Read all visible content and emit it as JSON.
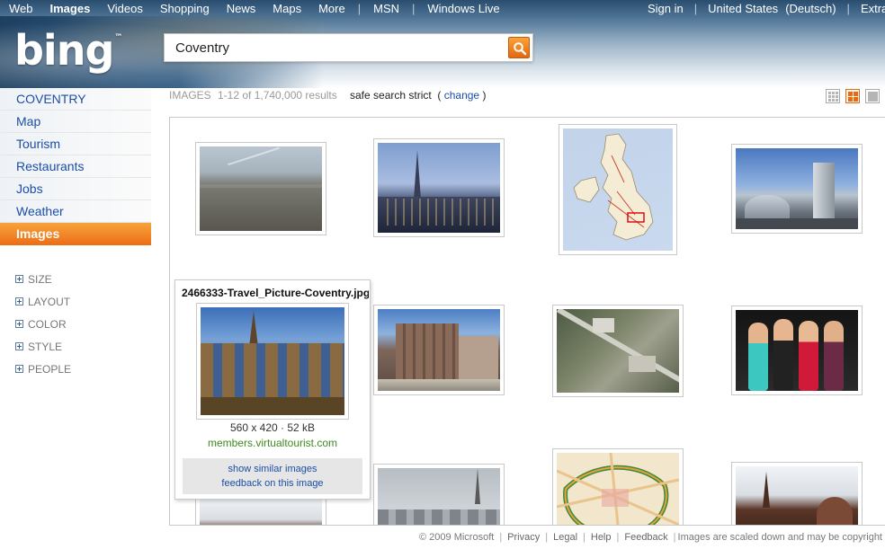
{
  "topnav": {
    "left": [
      "Web",
      "Images",
      "Videos",
      "Shopping",
      "News",
      "Maps",
      "More"
    ],
    "active": "Images",
    "msn": "MSN",
    "windows_live": "Windows Live",
    "sign_in": "Sign in",
    "region": "United States",
    "language": "(Deutsch)",
    "extras": "Extra"
  },
  "logo": {
    "text": "bing",
    "mark": "™"
  },
  "search": {
    "query": "Coventry",
    "button": "search-icon"
  },
  "sidebar": {
    "items": [
      {
        "label": "COVENTRY"
      },
      {
        "label": "Map"
      },
      {
        "label": "Tourism"
      },
      {
        "label": "Restaurants"
      },
      {
        "label": "Jobs"
      },
      {
        "label": "Weather"
      },
      {
        "label": "Images"
      }
    ],
    "filters": [
      "SIZE",
      "LAYOUT",
      "COLOR",
      "STYLE",
      "PEOPLE"
    ]
  },
  "results": {
    "label": "IMAGES",
    "count": "1-12 of 1,740,000 results",
    "safe_search": "safe search strict",
    "change": "change",
    "paren_open": "(",
    "paren_close": ")"
  },
  "preview": {
    "filename": "2466333-Travel_Picture-Coventry.jpg",
    "dimensions": "560 x 420 · 52 kB",
    "source": "members.virtualtourist.com",
    "similar": "show similar images",
    "feedback": "feedback on this image"
  },
  "footer": {
    "copyright": "© 2009 Microsoft",
    "links": [
      "Privacy",
      "Legal",
      "Help",
      "Feedback"
    ],
    "note": "Images are scaled down and may be copyright"
  },
  "colors": {
    "accent_orange": "#ec6d17",
    "link_blue": "#1b4ea8",
    "source_green": "#3c8c1e"
  }
}
